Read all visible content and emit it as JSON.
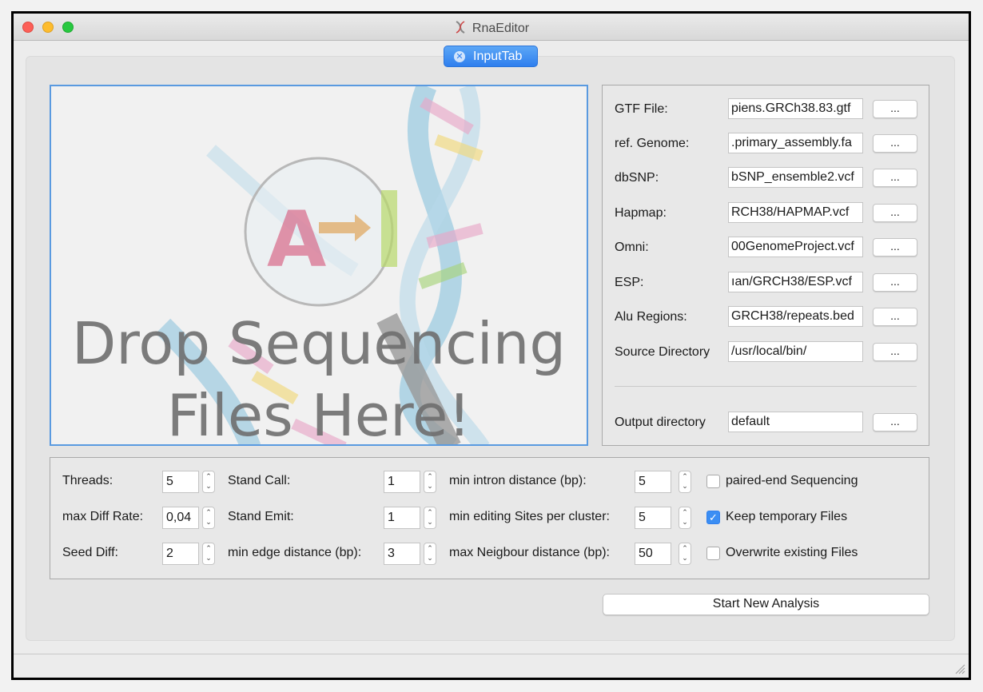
{
  "window": {
    "title": "RnaEditor"
  },
  "tab": {
    "label": "InputTab"
  },
  "dropzone": {
    "line1": "Drop Sequencing",
    "line2": "Files Here!",
    "logo_letters": [
      "A",
      "I"
    ]
  },
  "files": [
    {
      "label": "GTF File:",
      "value": "piens.GRCh38.83.gtf",
      "button": "..."
    },
    {
      "label": "ref. Genome:",
      "value": ".primary_assembly.fa",
      "button": "..."
    },
    {
      "label": "dbSNP:",
      "value": "bSNP_ensemble2.vcf",
      "button": "..."
    },
    {
      "label": "Hapmap:",
      "value": "RCH38/HAPMAP.vcf",
      "button": "..."
    },
    {
      "label": "Omni:",
      "value": "00GenomeProject.vcf",
      "button": "..."
    },
    {
      "label": "ESP:",
      "value": "ıan/GRCH38/ESP.vcf",
      "button": "..."
    },
    {
      "label": "Alu Regions:",
      "value": "GRCH38/repeats.bed",
      "button": "..."
    },
    {
      "label": "Source Directory",
      "value": "/usr/local/bin/",
      "button": "..."
    }
  ],
  "output": {
    "label": "Output directory",
    "value": "default",
    "button": "..."
  },
  "params": {
    "col1": [
      {
        "label": "Threads:",
        "value": "5"
      },
      {
        "label": "max Diff Rate:",
        "value": "0,04"
      },
      {
        "label": "Seed Diff:",
        "value": "2"
      }
    ],
    "col2": [
      {
        "label": "Stand Call:",
        "value": "1"
      },
      {
        "label": "Stand Emit:",
        "value": "1"
      },
      {
        "label": "min edge distance (bp):",
        "value": "3"
      }
    ],
    "col3": [
      {
        "label": "min intron distance (bp):",
        "value": "5"
      },
      {
        "label": "min editing Sites per cluster:",
        "value": "5"
      },
      {
        "label": "max Neigbour distance (bp):",
        "value": "50"
      }
    ],
    "checks": [
      {
        "label": "paired-end Sequencing",
        "checked": false
      },
      {
        "label": "Keep temporary Files",
        "checked": true
      },
      {
        "label": "Overwrite existing Files",
        "checked": false
      }
    ]
  },
  "actions": {
    "start_label": "Start New Analysis"
  },
  "colors": {
    "accent": "#2f7fee",
    "tab": "#3b8ef3"
  }
}
